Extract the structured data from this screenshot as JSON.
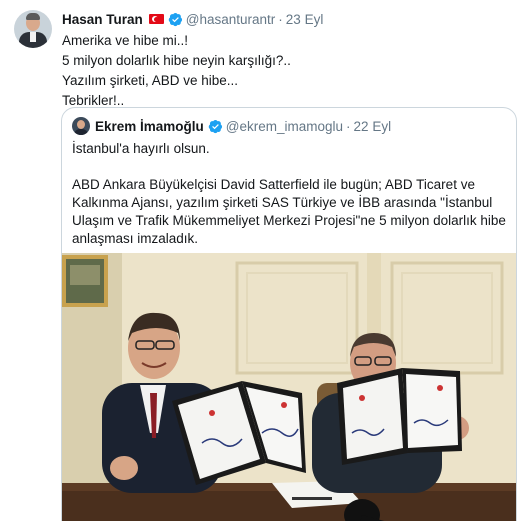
{
  "tweet": {
    "author_name": "Hasan Turan",
    "handle": "@hasanturantr",
    "separator": "·",
    "date": "23 Eyl",
    "lines": [
      "Amerika ve hibe mi..!",
      "5 milyon dolarlık hibe neyin karşılığı?..",
      "Yazılım şirketi, ABD ve hibe...",
      "Tebrikler!.."
    ]
  },
  "quote": {
    "author_name": "Ekrem İmamoğlu",
    "handle": "@ekrem_imamoglu",
    "separator": "·",
    "date": "22 Eyl",
    "text_line1": "İstanbul'a hayırlı olsun.",
    "text_line2": "ABD Ankara Büyükelçisi David Satterfield ile bugün; ABD Ticaret ve Kalkınma Ajansı, yazılım şirketi SAS Türkiye ve İBB arasında \"İstanbul Ulaşım ve Trafik Mükemmeliyet Merkezi Projesi\"ne 5 milyon dolarlık hibe anlaşması imzaladık."
  },
  "icons": {
    "verified": "verified-badge-icon",
    "flag": "turkey-flag-icon"
  },
  "colors": {
    "verified_blue": "#1da1f2",
    "muted_text": "#657786",
    "border": "#ccd6dd",
    "flag_red": "#e30a17"
  }
}
